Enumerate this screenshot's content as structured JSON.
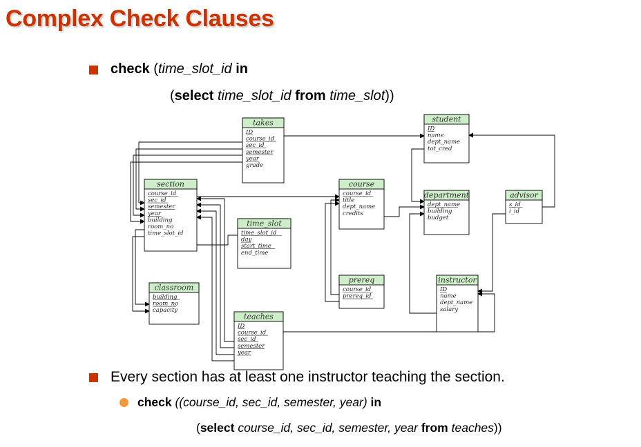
{
  "slide": {
    "title": "Complex Check Clauses",
    "bullet1": {
      "line1": {
        "kw_check": "check",
        "open": " (",
        "attr": "time_slot_id",
        "kw_in": " in"
      },
      "line2": {
        "open": "(",
        "kw_select": "select",
        "attr": " time_slot_id ",
        "kw_from": "from",
        "table": " time_slot",
        "close": "))"
      }
    },
    "bullet2": {
      "text": "Every section has at least one instructor teaching the section."
    },
    "sub_bullet": {
      "line1": {
        "kw_check": "check",
        "tuple": " ((course_id, sec_id, semester, year) ",
        "kw_in": " in"
      },
      "line2": {
        "open": "(",
        "kw_select": "select",
        "attrs": " course_id, sec_id, semester, year ",
        "kw_from": "from",
        "table": " teaches",
        "close": "))"
      }
    }
  },
  "diagram": {
    "header_color": "#cdeec8",
    "entities": [
      {
        "id": "takes",
        "title": "takes",
        "attrs": [
          {
            "t": "ID",
            "u": true
          },
          {
            "t": "course_id",
            "u": true
          },
          {
            "t": "sec_id",
            "u": true
          },
          {
            "t": "semester",
            "u": true
          },
          {
            "t": "year",
            "u": true
          },
          {
            "t": "grade",
            "u": false
          }
        ]
      },
      {
        "id": "student",
        "title": "student",
        "attrs": [
          {
            "t": "ID",
            "u": true
          },
          {
            "t": "name",
            "u": false
          },
          {
            "t": "dept_name",
            "u": false
          },
          {
            "t": "tot_cred",
            "u": false
          }
        ]
      },
      {
        "id": "section",
        "title": "section",
        "attrs": [
          {
            "t": "course_id",
            "u": true
          },
          {
            "t": "sec_id",
            "u": true
          },
          {
            "t": "semester",
            "u": true
          },
          {
            "t": "year",
            "u": true
          },
          {
            "t": "building",
            "u": false
          },
          {
            "t": "room_no",
            "u": false
          },
          {
            "t": "time_slot_id",
            "u": false
          }
        ]
      },
      {
        "id": "course",
        "title": "course",
        "attrs": [
          {
            "t": "course_id",
            "u": true
          },
          {
            "t": "title",
            "u": false
          },
          {
            "t": "dept_name",
            "u": false
          },
          {
            "t": "credits",
            "u": false
          }
        ]
      },
      {
        "id": "department",
        "title": "department",
        "attrs": [
          {
            "t": "dept_name",
            "u": true
          },
          {
            "t": "building",
            "u": false
          },
          {
            "t": "budget",
            "u": false
          }
        ]
      },
      {
        "id": "advisor",
        "title": "advisor",
        "attrs": [
          {
            "t": "s_id",
            "u": true
          },
          {
            "t": "i_id",
            "u": false
          }
        ]
      },
      {
        "id": "time_slot",
        "title": "time_slot",
        "attrs": [
          {
            "t": "time_slot_id",
            "u": true
          },
          {
            "t": "day",
            "u": true
          },
          {
            "t": "start_time",
            "u": true
          },
          {
            "t": "end_time",
            "u": false
          }
        ]
      },
      {
        "id": "prereq",
        "title": "prereq",
        "attrs": [
          {
            "t": "course_id",
            "u": true
          },
          {
            "t": "prereq_id",
            "u": true
          }
        ]
      },
      {
        "id": "instructor",
        "title": "instructor",
        "attrs": [
          {
            "t": "ID",
            "u": true
          },
          {
            "t": "name",
            "u": false
          },
          {
            "t": "dept_name",
            "u": false
          },
          {
            "t": "salary",
            "u": false
          }
        ]
      },
      {
        "id": "classroom",
        "title": "classroom",
        "attrs": [
          {
            "t": "building",
            "u": true
          },
          {
            "t": "room_no",
            "u": true
          },
          {
            "t": "capacity",
            "u": false
          }
        ]
      },
      {
        "id": "teaches",
        "title": "teaches",
        "attrs": [
          {
            "t": "ID",
            "u": true
          },
          {
            "t": "course_id",
            "u": true
          },
          {
            "t": "sec_id",
            "u": true
          },
          {
            "t": "semester",
            "u": true
          },
          {
            "t": "year",
            "u": true
          }
        ]
      }
    ]
  }
}
